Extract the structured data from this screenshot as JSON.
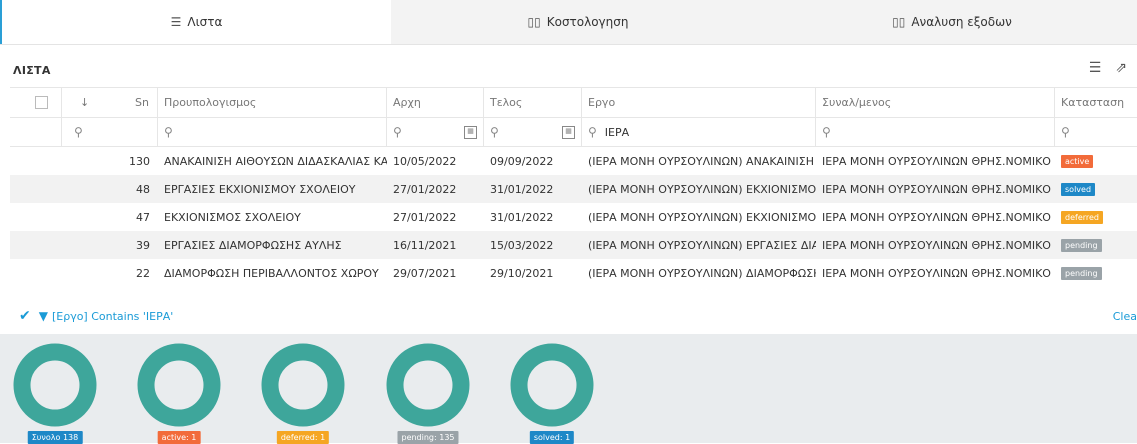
{
  "tabs": [
    {
      "label": "Λιστα",
      "icon": "list-icon"
    },
    {
      "label": "Κοστολογηση",
      "icon": "bar-chart-icon"
    },
    {
      "label": "Αναλυση εξοδων",
      "icon": "bar-chart-icon"
    }
  ],
  "list": {
    "title": "ΛΙΣΤΑ"
  },
  "columns": {
    "sn": "Sn",
    "budget": "Προυπολογισμος",
    "start": "Αρχη",
    "end": "Τελος",
    "project": "Εργο",
    "party": "Συναλ/μενος",
    "status": "Κατασταση"
  },
  "filters": {
    "project": "ΙΕΡΑ"
  },
  "rows": [
    {
      "sn": "130",
      "budget": "ΑΝΑΚΑΙΝΙΣΗ ΑΙΘΟΥΣΩΝ ΔΙΔΑΣΚΑΛΙΑΣ ΚΑΙ ΑΙ",
      "start": "10/05/2022",
      "end": "09/09/2022",
      "project": "(ΙΕΡΑ ΜΟΝΗ ΟΥΡΣΟΥΛΙΝΩΝ) ΑΝΑΚΑΙΝΙΣΗ ΑΙ",
      "party": "ΙΕΡΑ ΜΟΝΗ ΟΥΡΣΟΥΛΙΝΩΝ ΘΡΗΣ.ΝΟΜΙΚΟ Γ",
      "status": "active"
    },
    {
      "sn": "48",
      "budget": "ΕΡΓΑΣΙΕΣ ΕΚΧΙΟΝΙΣΜΟΥ ΣΧΟΛΕΙΟΥ",
      "start": "27/01/2022",
      "end": "31/01/2022",
      "project": "(ΙΕΡΑ ΜΟΝΗ ΟΥΡΣΟΥΛΙΝΩΝ) ΕΚΧΙΟΝΙΣΜΟΣ Σ",
      "party": "ΙΕΡΑ ΜΟΝΗ ΟΥΡΣΟΥΛΙΝΩΝ ΘΡΗΣ.ΝΟΜΙΚΟ Γ",
      "status": "solved"
    },
    {
      "sn": "47",
      "budget": "ΕΚΧΙΟΝΙΣΜΟΣ ΣΧΟΛΕΙΟΥ",
      "start": "27/01/2022",
      "end": "31/01/2022",
      "project": "(ΙΕΡΑ ΜΟΝΗ ΟΥΡΣΟΥΛΙΝΩΝ) ΕΚΧΙΟΝΙΣΜΟΣ Σ",
      "party": "ΙΕΡΑ ΜΟΝΗ ΟΥΡΣΟΥΛΙΝΩΝ ΘΡΗΣ.ΝΟΜΙΚΟ Γ",
      "status": "deferred"
    },
    {
      "sn": "39",
      "budget": "ΕΡΓΑΣΙΕΣ ΔΙΑΜΟΡΦΩΣΗΣ ΑΥΛΗΣ",
      "start": "16/11/2021",
      "end": "15/03/2022",
      "project": "(ΙΕΡΑ ΜΟΝΗ ΟΥΡΣΟΥΛΙΝΩΝ) ΕΡΓΑΣΙΕΣ ΔΙΑΜ",
      "party": "ΙΕΡΑ ΜΟΝΗ ΟΥΡΣΟΥΛΙΝΩΝ ΘΡΗΣ.ΝΟΜΙΚΟ Γ",
      "status": "pending"
    },
    {
      "sn": "22",
      "budget": "ΔΙΑΜΟΡΦΩΣΗ ΠΕΡΙΒΑΛΛΟΝΤΟΣ ΧΩΡΟΥ",
      "start": "29/07/2021",
      "end": "29/10/2021",
      "project": "(ΙΕΡΑ ΜΟΝΗ ΟΥΡΣΟΥΛΙΝΩΝ) ΔΙΑΜΟΡΦΩΣΗ",
      "party": "ΙΕΡΑ ΜΟΝΗ ΟΥΡΣΟΥΛΙΝΩΝ ΘΡΗΣ.ΝΟΜΙΚΟ Γ",
      "status": "pending"
    }
  ],
  "filter_bar": {
    "text": "[Εργο] Contains 'ΙΕΡΑ'",
    "clear": "Clea"
  },
  "summary": [
    {
      "label": "Συνολο 138",
      "color": "#1e88c7"
    },
    {
      "label": "active: 1",
      "color": "#f26b3a"
    },
    {
      "label": "deferred: 1",
      "color": "#f5a623"
    },
    {
      "label": "pending: 135",
      "color": "#9aa3a8"
    },
    {
      "label": "solved: 1",
      "color": "#1e88c7"
    }
  ],
  "colors": {
    "accent": "#1a9bd7",
    "donut": "#3ea69b"
  }
}
